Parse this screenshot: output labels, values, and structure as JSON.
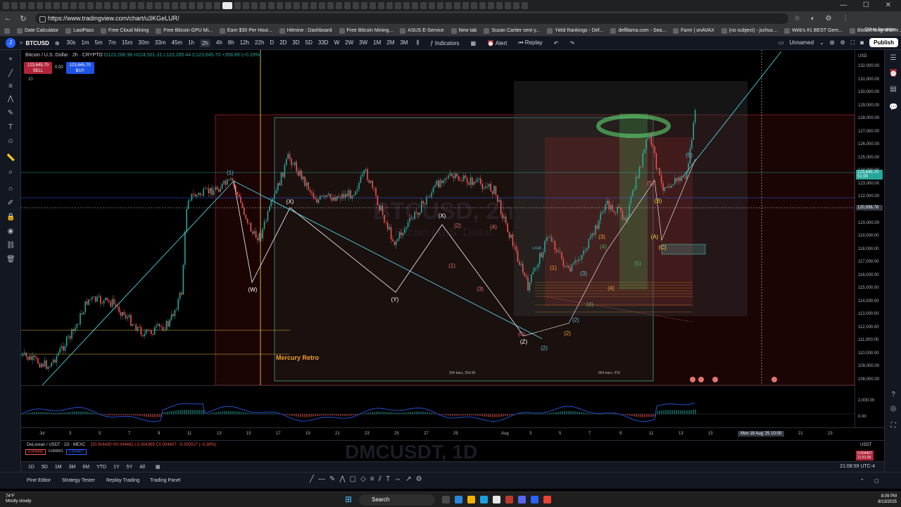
{
  "browser": {
    "url": "https://www.tradingview.com/chart/u3KGeLUR/",
    "bookmarks": [
      "Date Calculator",
      "LastPass",
      "Free Cloud Mining",
      "Free Bitcoin GPU Mi...",
      "Earn $30 Per Hour...",
      "Hitmine : Dashboard",
      "Free Bitcoin Mining...",
      "ASUS E-Service",
      "New tab",
      "Suzan Cartier sent y...",
      "Yield Rankings - Def...",
      "defillama.com - Sea...",
      "Farm | onAVAX",
      "(no subject) - jschuc...",
      "Web's #1 BEST Gem...",
      "Bitcoin long-short r...",
      "Bitcoin, Ethereum, a..."
    ],
    "other_favorites": "Other favorites"
  },
  "toolbar": {
    "symbol": "BTCUSD",
    "intervals": [
      "30s",
      "1m",
      "5m",
      "7m",
      "15m",
      "30m",
      "33m",
      "45m",
      "1h",
      "2h",
      "4h",
      "8h",
      "12h",
      "22h",
      "D",
      "2D",
      "3D",
      "5D",
      "33D",
      "W",
      "2W",
      "3W",
      "1M",
      "2M",
      "3M"
    ],
    "selected_interval": "2h",
    "indicators": "Indicators",
    "alert": "Alert",
    "replay": "Replay",
    "layout_name": "Unnamed",
    "publish": "Publish"
  },
  "legend": {
    "title": "Bitcoin / U.S. Dollar · 2h · CRYPTO",
    "ohlc": "O123,286.98 H124,501.31 L123,285.44 C123,645.70 +358.89 (+0.29%)",
    "sell_price": "123,645.70",
    "sell_label": "SELL",
    "spread": "0.00",
    "buy_price": "123,645.70",
    "buy_label": "BUY",
    "indicator_count": "10"
  },
  "watermark": {
    "symbol": "BTCUSD, 2h",
    "name": "Bitcoin / U.S. Dollar"
  },
  "price_scale": {
    "currency": "USD",
    "ticks": [
      "132,000.00",
      "131,000.00",
      "130,000.00",
      "129,000.00",
      "128,000.00",
      "127,000.00",
      "126,000.00",
      "125,000.00",
      "124,000.00",
      "123,000.00",
      "122,000.00",
      "121,000.00",
      "120,000.00",
      "119,000.00",
      "118,000.00",
      "117,000.00",
      "116,000.00",
      "115,000.00",
      "114,000.00",
      "113,000.00",
      "112,000.00",
      "111,000.00",
      "110,000.00",
      "109,000.00",
      "108,000.00"
    ],
    "last_price": "123,645.70",
    "countdown": "51:00",
    "crosshair_price": "120,936.78",
    "osc_ticks": [
      "2,000.00",
      "0.00"
    ]
  },
  "time_axis": {
    "labels": [
      "Jul",
      "3",
      "5",
      "7",
      "9",
      "11",
      "13",
      "15",
      "17",
      "19",
      "21",
      "23",
      "25",
      "27",
      "29",
      "Aug",
      "3",
      "5",
      "7",
      "9",
      "11",
      "13",
      "15",
      "21",
      "23"
    ],
    "crosshair_time": "Mon 18 Aug '25   10:00"
  },
  "annotations": {
    "mercury": "Mercury Retro",
    "range1": "304 bars, 25d 8h",
    "range2": "564 bars, 47d",
    "fib": "1.618"
  },
  "wave_labels": [
    {
      "t": "(1)",
      "c": "#5bc0de"
    },
    {
      "t": "(W)",
      "c": "#ffffff"
    },
    {
      "t": "(X)",
      "c": "#ffffff"
    },
    {
      "t": "(Y)",
      "c": "#ffffff"
    },
    {
      "t": "(X)",
      "c": "#ffffff"
    },
    {
      "t": "(Z)",
      "c": "#ffffff"
    },
    {
      "t": "(2)",
      "c": "#5bc0de"
    },
    {
      "t": "(5)",
      "c": "#5bc0de"
    },
    {
      "t": "(A)",
      "c": "#f5d547"
    },
    {
      "t": "(B)",
      "c": "#f5d547"
    },
    {
      "t": "(C)",
      "c": "#f5d547"
    },
    {
      "t": "(4)",
      "c": "#4caf50"
    },
    {
      "t": "(5)",
      "c": "#e57373"
    },
    {
      "t": "(1)",
      "c": "#f0a030"
    },
    {
      "t": "(2)",
      "c": "#f0a030"
    },
    {
      "t": "(3)",
      "c": "#f0a030"
    },
    {
      "t": "(4)",
      "c": "#f0a030"
    },
    {
      "t": "(2)",
      "c": "#5bc0de"
    },
    {
      "t": "(1)",
      "c": "#e57373"
    },
    {
      "t": "(2)",
      "c": "#e57373"
    },
    {
      "t": "(3)",
      "c": "#e57373"
    },
    {
      "t": "(4)",
      "c": "#e57373"
    },
    {
      "t": "(5)",
      "c": "#e57373"
    },
    {
      "t": "(3)",
      "c": "#5bc0de"
    },
    {
      "t": "(4)",
      "c": "#4caf50"
    },
    {
      "t": "(5)",
      "c": "#4caf50"
    }
  ],
  "pane2": {
    "header": "DeLorean / USDT · 1D · MEXC",
    "ohlc": "O0.004430 H0.004462 L0.004389 C0.004407 −0.000017 (−0.38%)",
    "sell": "0.004406",
    "spread": "0.000001",
    "buy": "0.004407",
    "watermark": "DMCUSDT, 1D",
    "prices": [
      "0.004407",
      "21:51:00"
    ],
    "currency": "USDT"
  },
  "range_bar": {
    "ranges": [
      "1D",
      "5D",
      "1M",
      "3M",
      "6M",
      "YTD",
      "1Y",
      "5Y",
      "All"
    ],
    "clock": "21:08:59 UTC-4"
  },
  "bottom_panels": [
    "Pine Editor",
    "Strategy Tester",
    "Replay Trading",
    "Trading Panel"
  ],
  "taskbar": {
    "weather_temp": "74°F",
    "weather_desc": "Mostly cloudy",
    "search": "Search",
    "time": "8:09 PM",
    "date": "8/13/2025"
  },
  "colors": {
    "up": "#26a69a",
    "down": "#ef5350",
    "accent": "#2962ff",
    "bg": "#000000",
    "panel": "#131722"
  }
}
